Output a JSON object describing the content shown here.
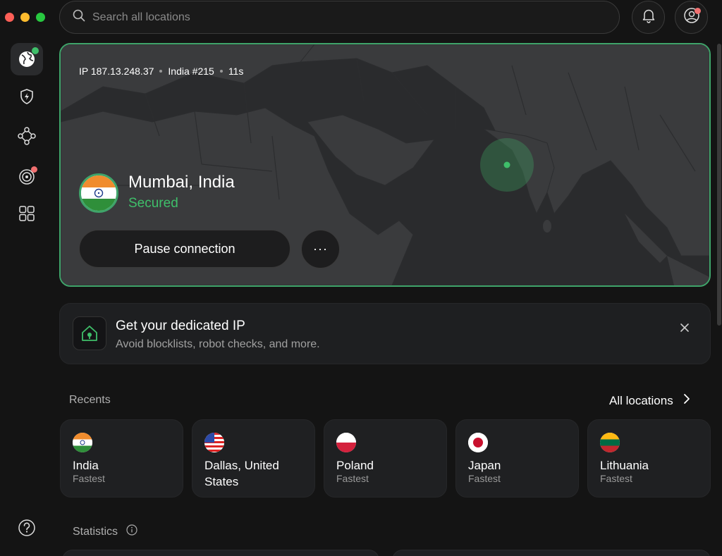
{
  "search": {
    "placeholder": "Search all locations"
  },
  "connection": {
    "ip": "IP 187.13.248.37",
    "server": "India #215",
    "duration": "11s",
    "location": "Mumbai, India",
    "status": "Secured",
    "pause_label": "Pause connection",
    "more_label": "···"
  },
  "promo": {
    "title": "Get your dedicated IP",
    "subtitle": "Avoid blocklists, robot checks, and more."
  },
  "recents": {
    "label": "Recents",
    "all_locations": "All locations",
    "items": [
      {
        "name": "India",
        "sub": "Fastest",
        "flag": "india"
      },
      {
        "name": "Dallas, United States",
        "sub": "",
        "flag": "usa"
      },
      {
        "name": "Poland",
        "sub": "Fastest",
        "flag": "poland"
      },
      {
        "name": "Japan",
        "sub": "Fastest",
        "flag": "japan"
      },
      {
        "name": "Lithuania",
        "sub": "Fastest",
        "flag": "lithuania"
      }
    ]
  },
  "statistics": {
    "label": "Statistics"
  },
  "colors": {
    "accent": "#3fbf6a",
    "map_bg": "#2a2b2d",
    "land": "#3a3b3d",
    "alert_dot": "#f07070"
  }
}
